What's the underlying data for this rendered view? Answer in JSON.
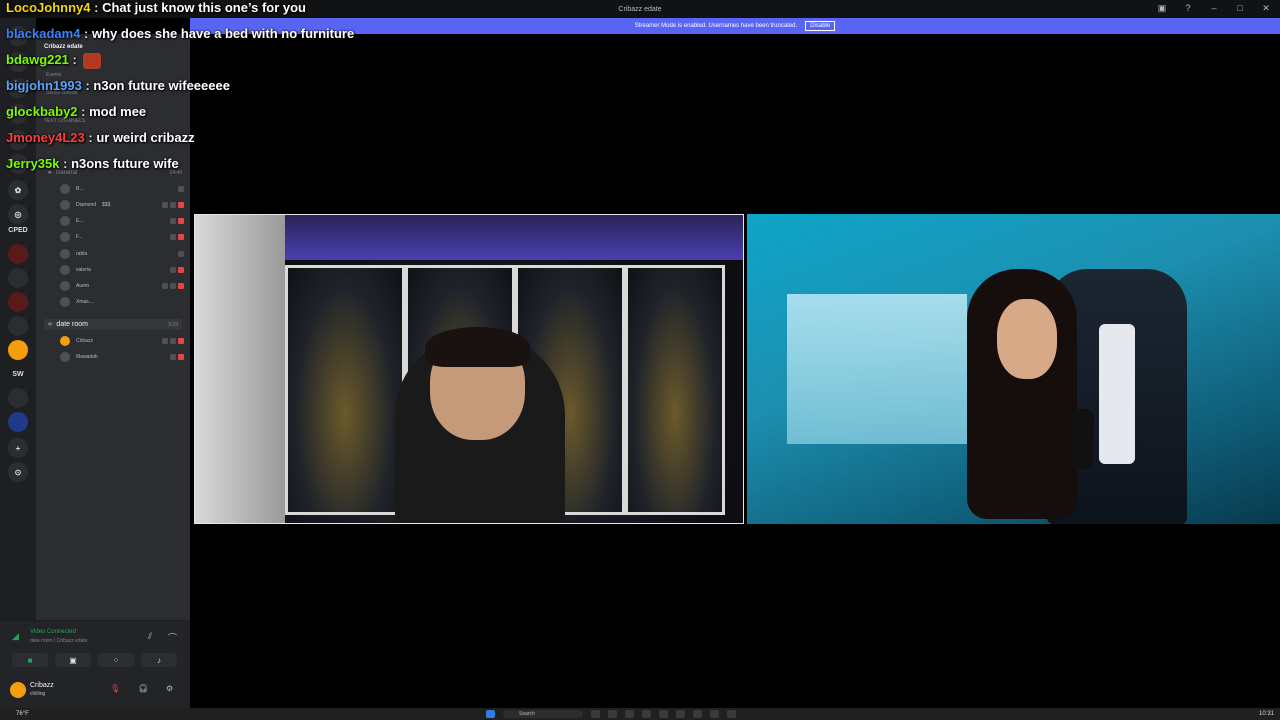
{
  "window": {
    "title": "Cribazz edate",
    "buttons": [
      "minimize",
      "maximize",
      "close"
    ]
  },
  "banner": {
    "text": "Streamer Mode is enabled. Usernames have been truncated.",
    "button": "Disable"
  },
  "chat": [
    {
      "user": "LocoJohnny4",
      "color": "#f5d90a",
      "text": "Chat just know this one’s for you"
    },
    {
      "user": "blackadam4",
      "color": "#3b82f6",
      "text": "why does she have a bed with no furniture"
    },
    {
      "user": "bdawg221",
      "color": "#7cfc00",
      "text": "",
      "emote": true
    },
    {
      "user": "bigjohn1993",
      "color": "#60a5fa",
      "text": "n3on future wifeeeeee"
    },
    {
      "user": "glockbaby2",
      "color": "#7cfc00",
      "text": "mod mee"
    },
    {
      "user": "Jmoney4L23",
      "color": "#ff3b3b",
      "text": "ur weird cribazz"
    },
    {
      "user": "Jerry35k",
      "color": "#7cfc00",
      "text": "n3ons future wife"
    }
  ],
  "servers": {
    "labels": [
      "CPED",
      "SW"
    ]
  },
  "sidebar": {
    "server_name": "Cribazz edate",
    "events": "Events",
    "server_boosts": "Server Boosts",
    "text_channels": "Text Channels",
    "voice_channel_general": {
      "name": "General",
      "time": "14:49"
    },
    "general_members": [
      {
        "name": "B..."
      },
      {
        "name": "Diamond",
        "tag": "$$$"
      },
      {
        "name": "E..."
      },
      {
        "name": "F..."
      },
      {
        "name": "rabia"
      },
      {
        "name": "valeria"
      },
      {
        "name": "Auem"
      },
      {
        "name": "Xmas...."
      }
    ],
    "voice_channel_date": {
      "name": "date room",
      "time": "3:29"
    },
    "date_members": [
      {
        "name": "Cribazz"
      },
      {
        "name": "Mawadah"
      }
    ]
  },
  "voice_panel": {
    "status": "Video Connected",
    "location": "date room / Cribazz edate"
  },
  "user_panel": {
    "name": "Cribazz",
    "status": "chilling"
  },
  "taskbar": {
    "weather": "76°F",
    "search": "Search",
    "clock": "10:31"
  }
}
